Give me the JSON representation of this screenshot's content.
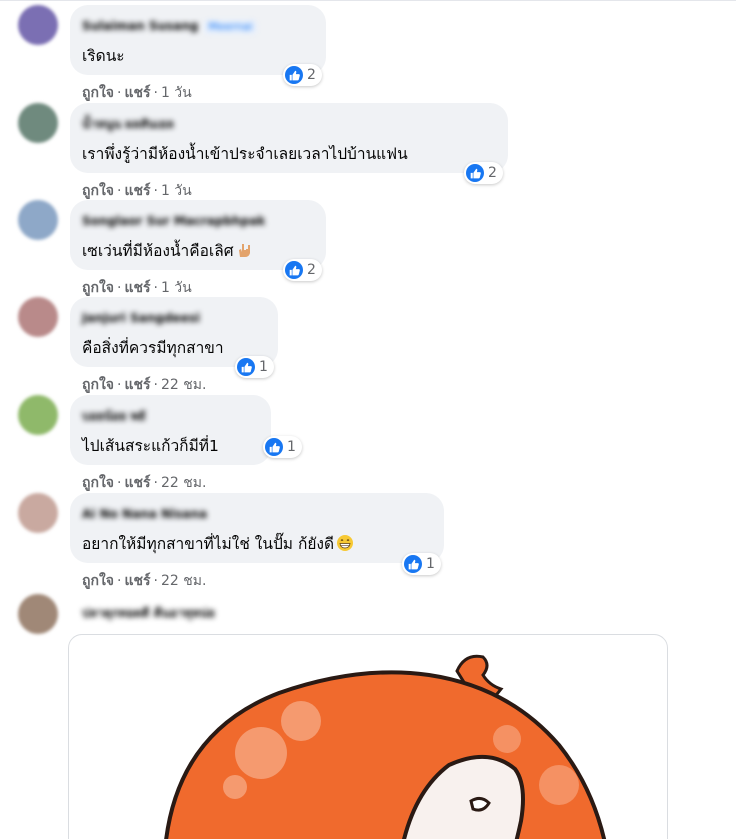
{
  "action_labels": {
    "like": "ถูกใจ",
    "reply": "แชร์",
    "separator": "·"
  },
  "comments": [
    {
      "author": "Sulaiman Susang",
      "badge": "Meernai",
      "text": "เริดนะ",
      "reactions": "2",
      "time": "1 วัน",
      "avatar_color": "#7b6fb3"
    },
    {
      "author": "น้ำหนูน ผลสันเยล",
      "text": "เราพึ่งรู้ว่ามีห้องน้ำเข้าประจำเลยเวลาไปบ้านแฟน",
      "reactions": "2",
      "time": "1 วัน",
      "avatar_color": "#6f8a7e"
    },
    {
      "author": "Songlaor Sur Macrapbhpak",
      "text": "เซเว่นที่มีห้องน้ำคือเลิศ",
      "reactions": "2",
      "time": "1 วัน",
      "avatar_color": "#8ea8c8"
    },
    {
      "author": "Janjuri Sangdeesi",
      "text": "คือสิ่งที่ควรมีทุกสาขา",
      "reactions": "1",
      "time": "22 ชม.",
      "avatar_color": "#b98a8a"
    },
    {
      "author": "บอยน้อย พยั",
      "text": "ไปเส้นสระแก้วก็มีที่1",
      "reactions": "1",
      "time": "22 ชม.",
      "avatar_color": "#8fb96a"
    },
    {
      "author": "Ai No Nana Nisana",
      "text": "อยากให้มีทุกสาขาที่ไม่ใช่ ในปั๊ม ก้ยังดี",
      "reactions": "1",
      "time": "22 ชม.",
      "avatar_color": "#c9a9a0"
    }
  ],
  "last_comment": {
    "author": "ปลาดุกทอดดี คืนอาทุหน่ย",
    "avatar_color": "#a08877"
  },
  "colors": {
    "like_blue": "#1877f2",
    "bubble_bg": "#f0f2f5",
    "meta_gray": "#65676b",
    "sticker_orange": "#f06a2d"
  }
}
